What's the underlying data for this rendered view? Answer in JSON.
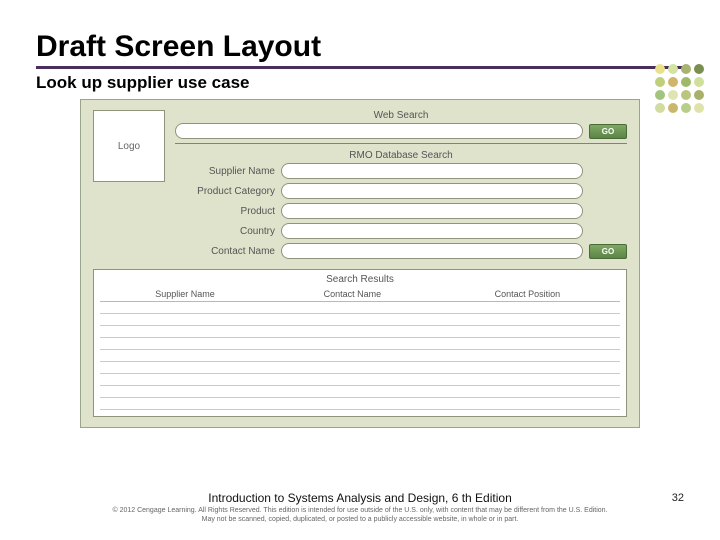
{
  "title": "Draft Screen Layout",
  "subtitle": "Look up supplier use case",
  "logo": "Logo",
  "webSearch": {
    "label": "Web Search",
    "go": "GO"
  },
  "rmo": {
    "label": "RMO Database Search",
    "supplierName": "Supplier Name",
    "productCategory": "Product Category",
    "product": "Product",
    "country": "Country",
    "contactName": "Contact Name",
    "go": "GO"
  },
  "results": {
    "title": "Search Results",
    "cols": {
      "supplier": "Supplier Name",
      "contact": "Contact Name",
      "position": "Contact Position"
    }
  },
  "footerMain": "Introduction to Systems Analysis and Design, 6 th Edition",
  "footerCopy1": "© 2012 Cengage Learning. All Rights Reserved. This edition is intended for use outside of the U.S. only, with content that may be different from the U.S. Edition.",
  "footerCopy2": "May not be scanned, copied, duplicated, or posted to a publicly accessible website, in whole or in part.",
  "pageNum": "32"
}
